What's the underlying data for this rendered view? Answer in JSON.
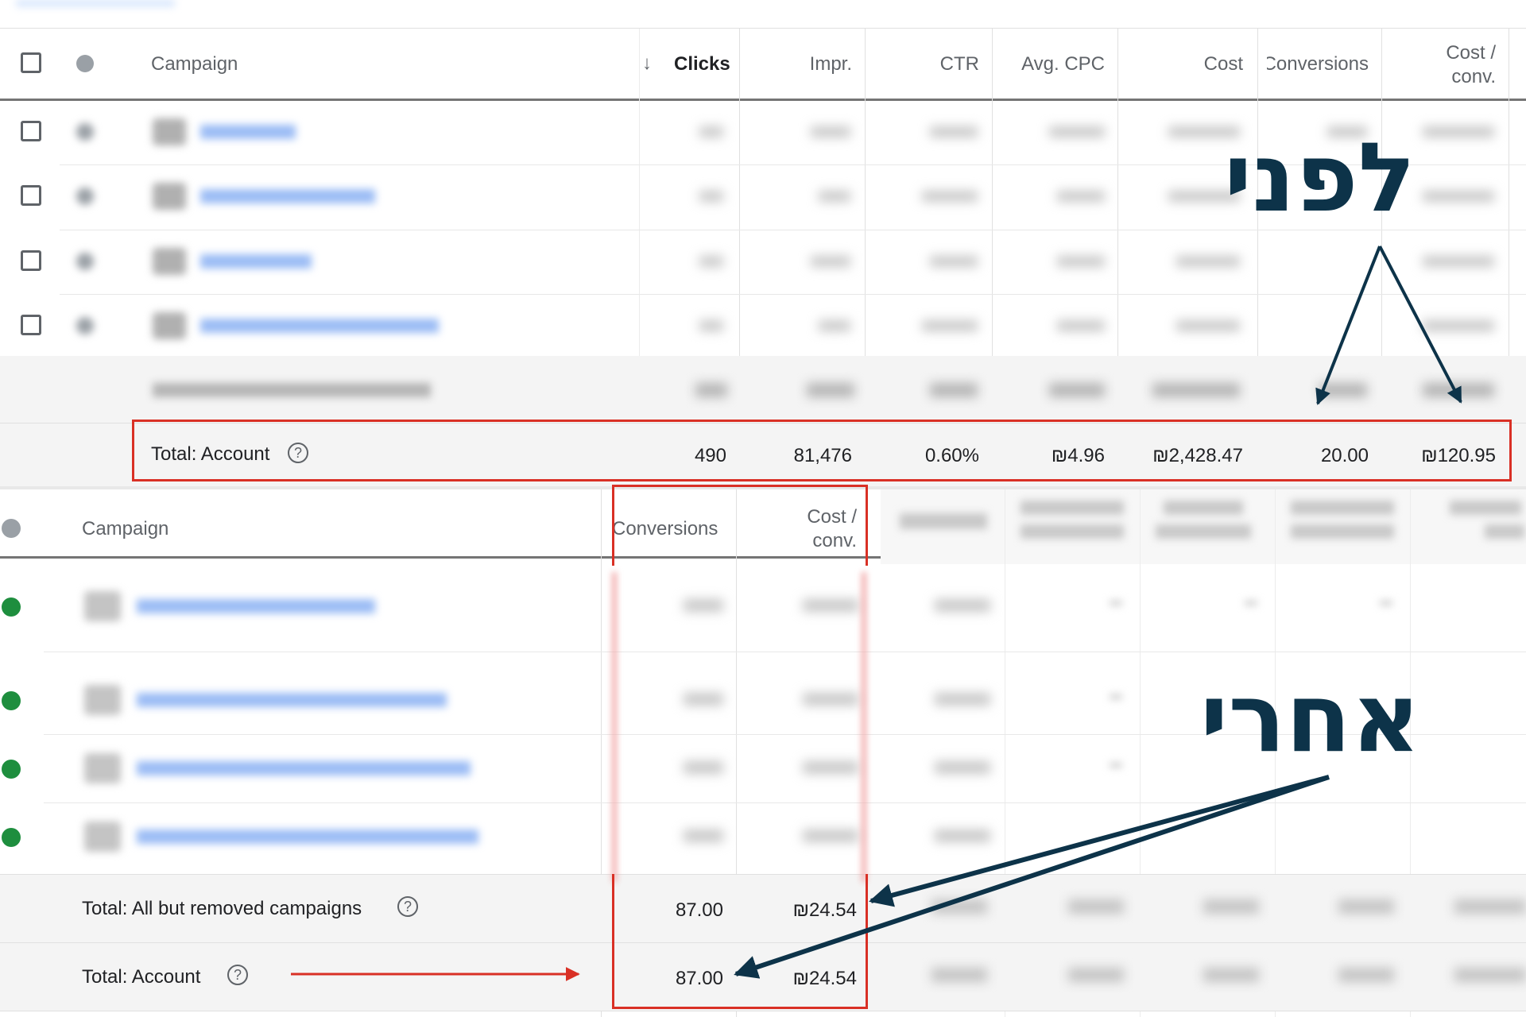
{
  "top_table": {
    "header": {
      "campaign": "Campaign",
      "clicks": "Clicks",
      "impr": "Impr.",
      "ctr": "CTR",
      "avg_cpc": "Avg. CPC",
      "cost": "Cost",
      "conversions": "Conversions",
      "cost_conv_1": "Cost /",
      "cost_conv_2": "conv."
    },
    "total_account": {
      "label": "Total: Account",
      "clicks": "490",
      "impr": "81,476",
      "ctr": "0.60%",
      "avg_cpc": "₪4.96",
      "cost": "₪2,428.47",
      "conversions": "20.00",
      "cost_conv": "₪120.95"
    }
  },
  "bottom_table": {
    "header": {
      "campaign": "Campaign",
      "conversions": "Conversions",
      "cost_conv_1": "Cost /",
      "cost_conv_2": "conv."
    },
    "total_all_but_removed": {
      "label": "Total: All but removed campaigns",
      "conversions": "87.00",
      "cost_conv": "₪24.54"
    },
    "total_account": {
      "label": "Total: Account",
      "conversions": "87.00",
      "cost_conv": "₪24.54"
    }
  },
  "annotations": {
    "before": "לפני",
    "after": "אחרי",
    "color": "#0d3349",
    "highlight_color": "#d93025"
  },
  "icons": {
    "help": "?",
    "sort": "↓"
  }
}
